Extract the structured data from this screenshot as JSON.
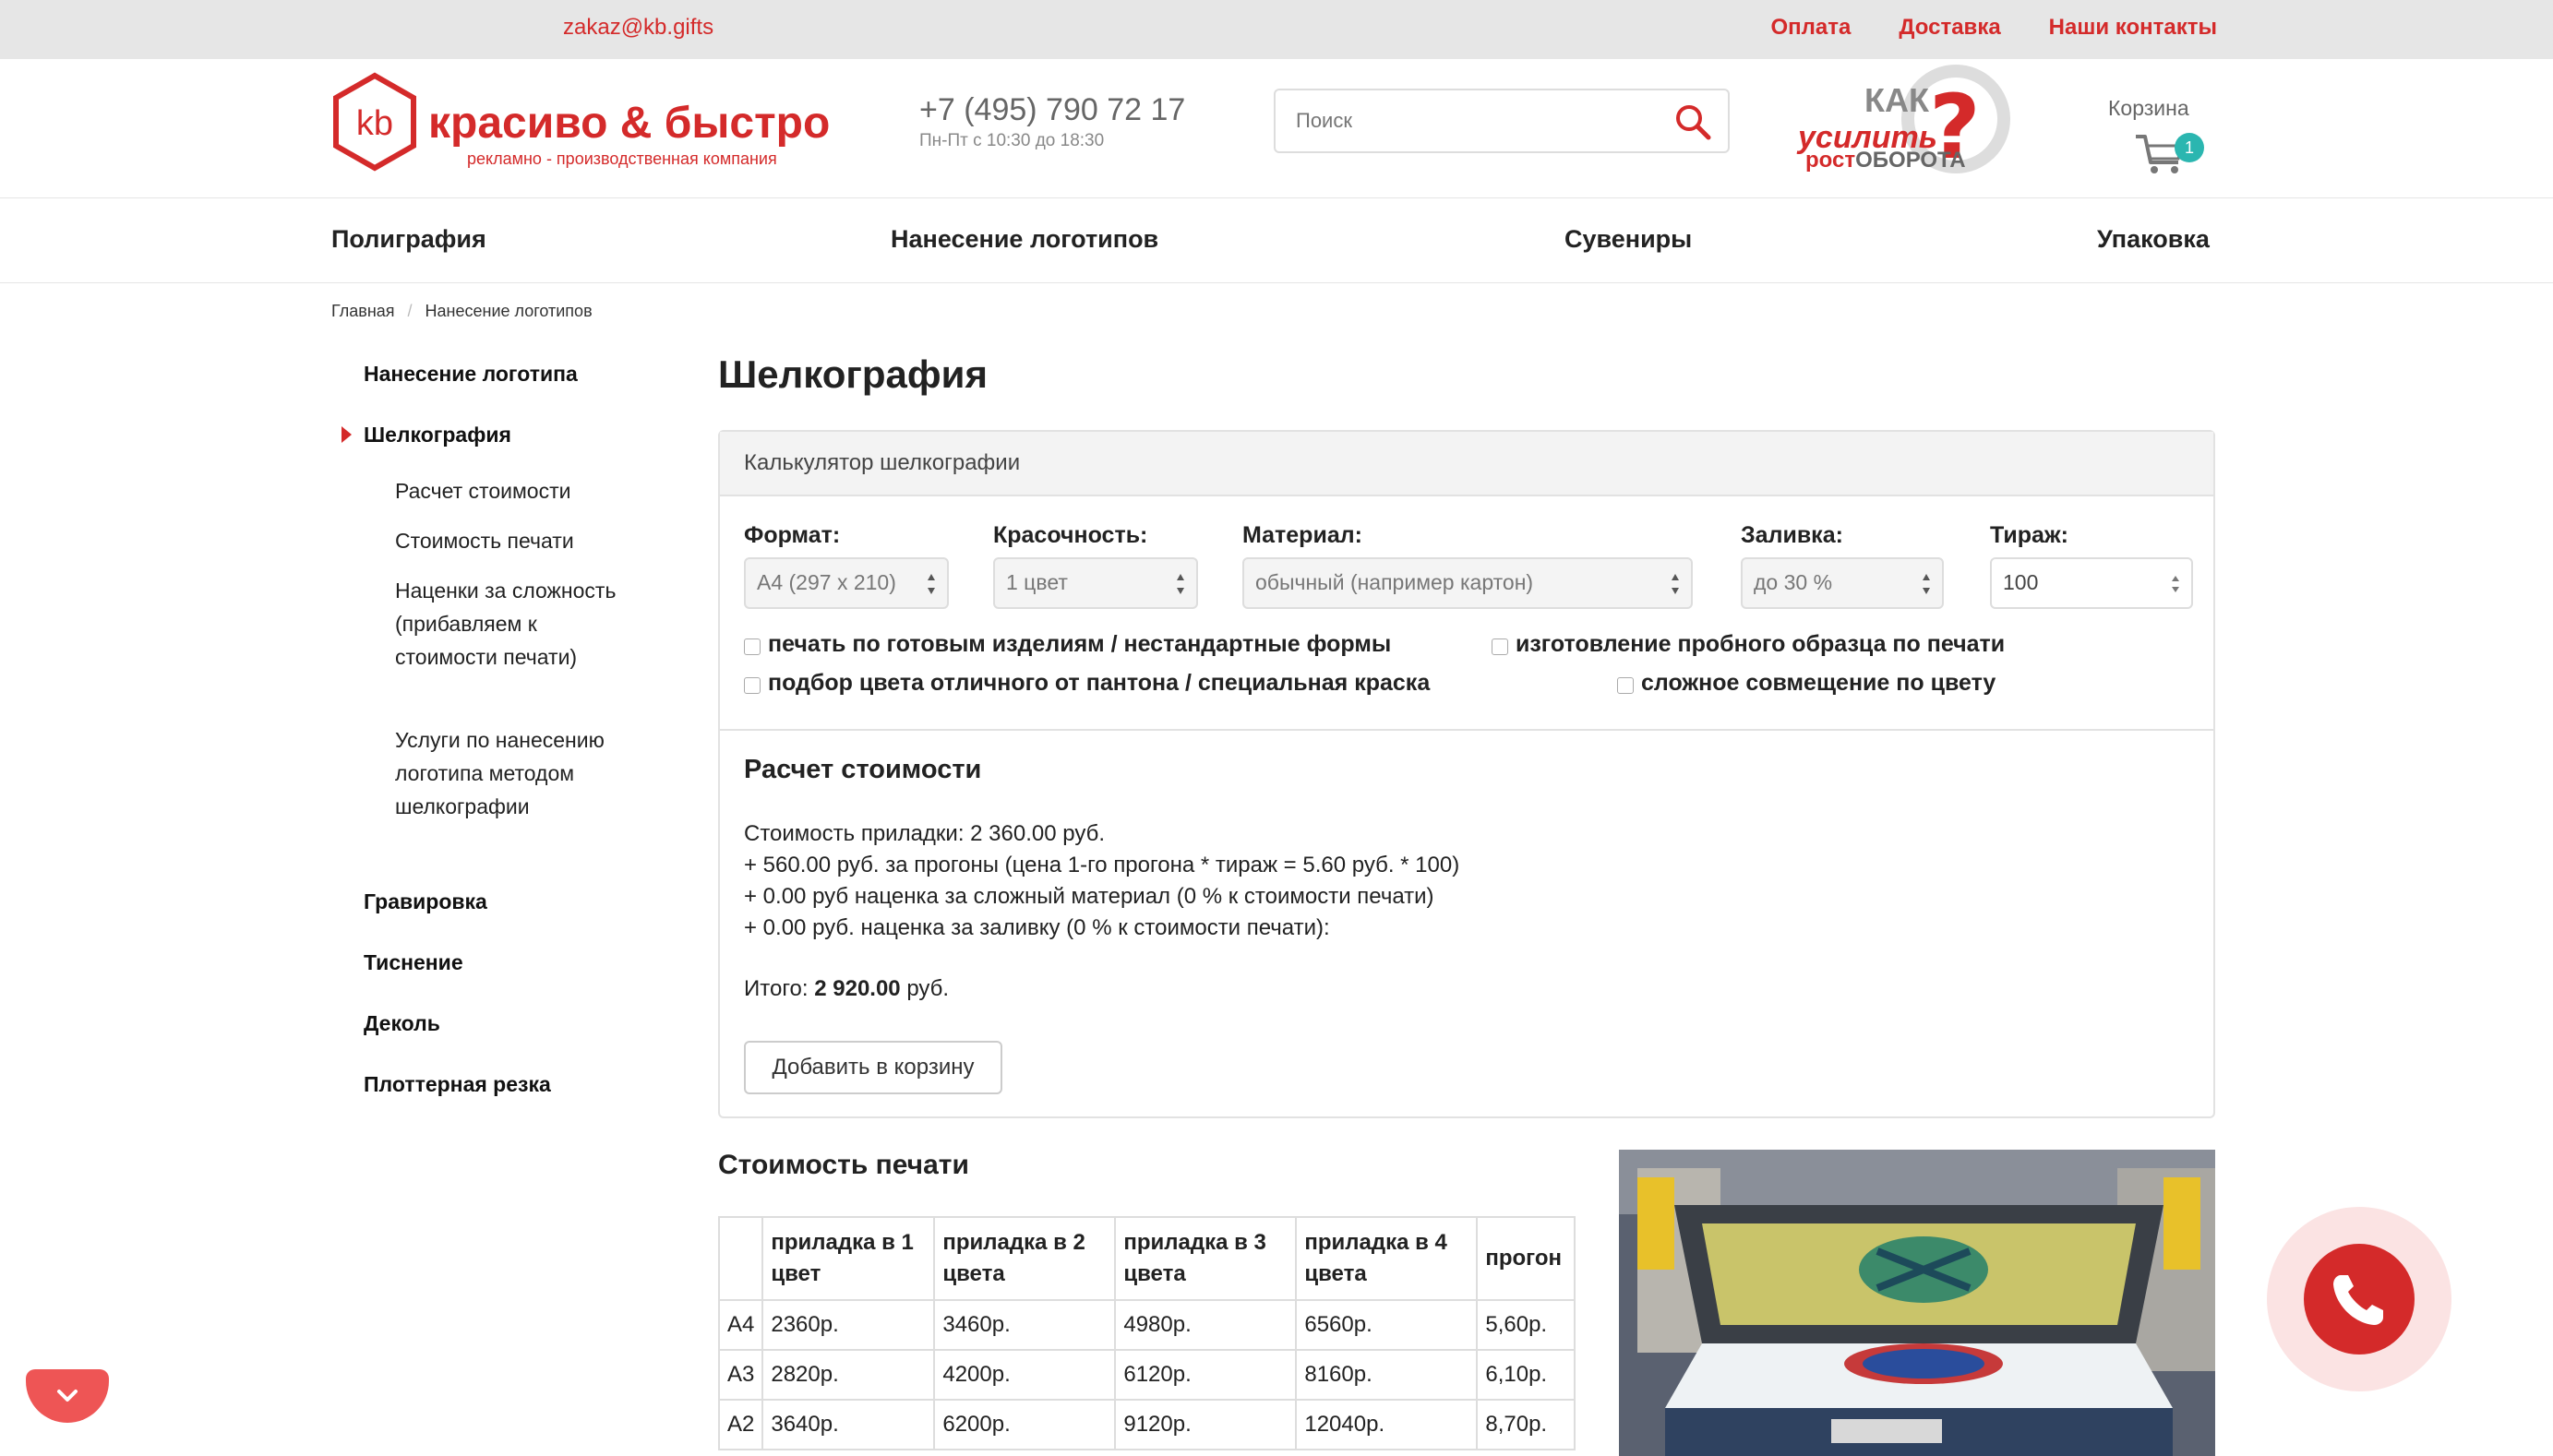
{
  "topbar": {
    "email": "zakaz@kb.gifts",
    "links": [
      "Оплата",
      "Доставка",
      "Наши контакты"
    ]
  },
  "header": {
    "logo_brand": "красиво & быстро",
    "logo_mark": "kb",
    "logo_tagline": "рекламно - производственная компания",
    "phone": "+7 (495) 790 72 17",
    "hours": "Пн-Пт с 10:30 до 18:30",
    "search_placeholder": "Поиск",
    "promo": {
      "line1": "КАК",
      "line2": "усилить",
      "line3a": "рост",
      "line3b": "ОБОРОТА",
      "mark": "?"
    },
    "cart_label": "Корзина",
    "cart_count": "1"
  },
  "nav": [
    "Полиграфия",
    "Нанесение логотипов",
    "Сувениры",
    "Упаковка"
  ],
  "breadcrumb": [
    "Главная",
    "Нанесение логотипов"
  ],
  "sidebar": {
    "items": [
      {
        "label": "Нанесение логотипа"
      },
      {
        "label": "Шелкография",
        "active": true
      },
      {
        "label": "Гравировка"
      },
      {
        "label": "Тиснение"
      },
      {
        "label": "Деколь"
      },
      {
        "label": "Плоттерная резка"
      }
    ],
    "subitems": [
      "Расчет стоимости",
      "Стоимость печати",
      "Наценки за сложность (прибавляем к стоимости печати)",
      "Услуги по нанесению логотипа методом шелкографии"
    ]
  },
  "page_title": "Шелкография",
  "calculator": {
    "title": "Калькулятор шелкографии",
    "fields": [
      {
        "label": "Формат:",
        "value": "А4 (297 х 210)"
      },
      {
        "label": "Красочность:",
        "value": "1 цвет"
      },
      {
        "label": "Материал:",
        "value": "обычный (например картон)"
      },
      {
        "label": "Заливка:",
        "value": "до 30 %"
      },
      {
        "label": "Тираж:",
        "value": "100"
      }
    ],
    "checkboxes": [
      "печать по готовым изделиям / нестандартные формы",
      "изготовление пробного образца по печати",
      "подбор цвета отличного от пантона / специальная краска",
      "сложное совмещение по цвету"
    ],
    "result": {
      "title": "Расчет стоимости",
      "lines": [
        "Стоимость приладки: 2 360.00 руб.",
        "+ 560.00 руб. за прогоны (цена 1-го прогона * тираж = 5.60 руб. * 100)",
        "+ 0.00 руб наценка за сложный материал (0 % к стоимости печати)",
        "+ 0.00 руб. наценка за заливку (0 % к стоимости печати):"
      ],
      "total_label": "Итого:",
      "total_value": "2 920.00",
      "total_unit": "руб."
    },
    "add_to_cart": "Добавить в корзину"
  },
  "price_table": {
    "title": "Стоимость печати",
    "headers": [
      "",
      "приладка в 1 цвет",
      "приладка в 2 цвета",
      "приладка в 3 цвета",
      "приладка в 4 цвета",
      "прогон"
    ],
    "rows": [
      [
        "А4",
        "2360р.",
        "3460р.",
        "4980р.",
        "6560р.",
        "5,60р."
      ],
      [
        "А3",
        "2820р.",
        "4200р.",
        "6120р.",
        "8160р.",
        "6,10р."
      ],
      [
        "А2",
        "3640р.",
        "6200р.",
        "9120р.",
        "12040р.",
        "8,70р."
      ]
    ]
  },
  "colors": {
    "accent": "#d42a2a",
    "badge": "#2bb6b0"
  }
}
